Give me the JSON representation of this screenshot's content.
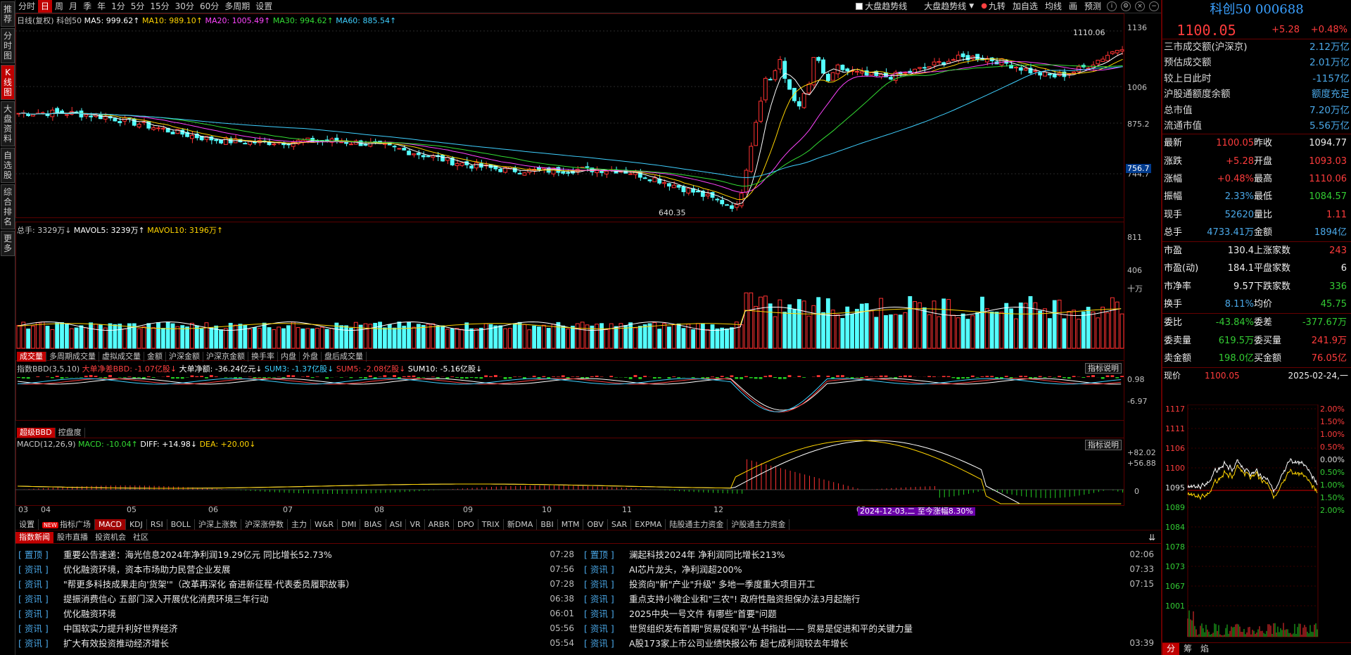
{
  "left_tabs": [
    "推荐",
    "分时图",
    "K线图",
    "大盘资料",
    "自选股",
    "综合排名",
    "更多"
  ],
  "toolbar": {
    "periods": [
      "分时",
      "日",
      "周",
      "月",
      "季",
      "年",
      "1分",
      "5分",
      "15分",
      "30分",
      "60分",
      "多周期",
      "设置"
    ],
    "active_period": "日",
    "right_items": [
      "大盘趋势线",
      "大盘趋势线",
      "九转",
      "加自选",
      "均线",
      "画",
      "预测"
    ],
    "icons": [
      "info-icon",
      "settings-icon",
      "close-icon",
      "minimize-icon"
    ]
  },
  "price_pane": {
    "title_parts": [
      {
        "t": "日线(复权)",
        "c": "#c8c8c8"
      },
      {
        "t": "科创50",
        "c": "#c8c8c8"
      },
      {
        "t": "MA5: 999.62↑",
        "c": "#ffffff"
      },
      {
        "t": "MA10: 989.10↑",
        "c": "#ffd400"
      },
      {
        "t": "MA20: 1005.49↑",
        "c": "#ff44ff"
      },
      {
        "t": "MA30: 994.62↑",
        "c": "#33dd33"
      },
      {
        "t": "MA60: 885.54↑",
        "c": "#3fd0ff"
      }
    ],
    "y_ticks": [
      "1136",
      "1006",
      "875.2",
      "744.7"
    ],
    "current_tag": "756.7",
    "high_label": "1110.06",
    "low_label": "640.35"
  },
  "volume_pane": {
    "title_parts": [
      {
        "t": "总手: 3329万↓",
        "c": "#c8c8c8"
      },
      {
        "t": "MAVOL5: 3239万↑",
        "c": "#ffffff"
      },
      {
        "t": "MAVOL10: 3196万↑",
        "c": "#ffd400"
      }
    ],
    "y_ticks": [
      "811",
      "406",
      "十万"
    ],
    "sub_tabs": [
      "成交量",
      "多周期成交量",
      "虚拟成交量",
      "金额",
      "沪深金额",
      "沪深京金额",
      "换手率",
      "内盘",
      "外盘",
      "盘后成交量"
    ]
  },
  "bbd_pane": {
    "title_parts": [
      {
        "t": "指数BBD(3,5,10)",
        "c": "#c8c8c8"
      },
      {
        "t": "大单净差BBD: -1.07亿股↓",
        "c": "#ff4040"
      },
      {
        "t": "大单净额: -36.24亿元↓",
        "c": "#ffffff"
      },
      {
        "t": "SUM3: -1.37亿股↓",
        "c": "#3fd0ff"
      },
      {
        "t": "SUM5: -2.08亿股↓",
        "c": "#ff4040"
      },
      {
        "t": "SUM10: -5.16亿股↓",
        "c": "#ffffff"
      }
    ],
    "y_ticks": [
      "0.98",
      "-6.97"
    ],
    "button": "指标说明",
    "sub_tabs": [
      "超级BBD",
      "控盘度"
    ]
  },
  "macd_pane": {
    "title_parts": [
      {
        "t": "MACD(12,26,9)",
        "c": "#c8c8c8"
      },
      {
        "t": "MACD: -10.04↑",
        "c": "#33dd33"
      },
      {
        "t": "DIFF: +14.98↓",
        "c": "#ffffff"
      },
      {
        "t": "DEA: +20.00↓",
        "c": "#ffd400"
      }
    ],
    "y_ticks": [
      "+82.02",
      "+56.88",
      "0"
    ],
    "button": "指标说明"
  },
  "x_axis": [
    "03",
    "04",
    "05",
    "06",
    "07",
    "08",
    "09",
    "10",
    "11",
    "12",
    "02"
  ],
  "indicator_tabs": [
    "设置",
    "指标广场",
    "MACD",
    "KDJ",
    "RSI",
    "BOLL",
    "沪深上涨数",
    "沪深涨停数",
    "主力",
    "W&R",
    "DMI",
    "BIAS",
    "ASI",
    "VR",
    "ARBR",
    "DPO",
    "TRIX",
    "新DMA",
    "BBI",
    "MTM",
    "OBV",
    "SAR",
    "EXPMA",
    "陆股通主力资金",
    "沪股通主力资金"
  ],
  "active_indicator": "MACD",
  "new_badge": "NEW",
  "range_tag": "2024-12-03,二 至今涨幅8.30%",
  "news_tabs": [
    "指数新闻",
    "股市直播",
    "投资机会",
    "社区"
  ],
  "news_left": [
    {
      "tag": "[ 置顶 ]",
      "title": "重要公告速递：海光信息2024年净利润19.29亿元 同比增长52.73%",
      "time": "07:28"
    },
    {
      "tag": "[ 资讯 ]",
      "title": "优化融资环境，资本市场助力民营企业发展",
      "time": "07:56"
    },
    {
      "tag": "[ 资讯 ]",
      "title": "\"帮更多科技成果走向'货架'\"（改革再深化 奋进新征程·代表委员履职故事）",
      "time": "07:28"
    },
    {
      "tag": "[ 资讯 ]",
      "title": "提振消费信心 五部门深入开展优化消费环境三年行动",
      "time": "06:38"
    },
    {
      "tag": "[ 资讯 ]",
      "title": "优化融资环境",
      "time": "06:01"
    },
    {
      "tag": "[ 资讯 ]",
      "title": "中国软实力提升利好世界经济",
      "time": "05:56"
    },
    {
      "tag": "[ 资讯 ]",
      "title": "扩大有效投资推动经济增长",
      "time": "05:54"
    }
  ],
  "news_right": [
    {
      "tag": "[ 置顶 ]",
      "title": "澜起科技2024年 净利润同比增长213%",
      "time": "02:06"
    },
    {
      "tag": "[ 资讯 ]",
      "title": "AI芯片龙头，净利润超200%",
      "time": "07:33"
    },
    {
      "tag": "[ 资讯 ]",
      "title": "投资向\"新\"产业\"升级\" 多地一季度重大项目开工",
      "time": "07:15"
    },
    {
      "tag": "[ 资讯 ]",
      "title": "重点支持小微企业和\"三农\"! 政府性融资担保办法3月起施行",
      "time": ""
    },
    {
      "tag": "[ 资讯 ]",
      "title": "2025中央一号文件 有哪些\"首要\"问题",
      "time": ""
    },
    {
      "tag": "[ 资讯 ]",
      "title": "世贸组织发布首期\"贸易促和平\"丛书指出—— 贸易是促进和平的关键力量",
      "time": ""
    },
    {
      "tag": "[ 资讯 ]",
      "title": "A股173家上市公司业绩快报公布 超七成利润较去年增长",
      "time": "03:39"
    }
  ],
  "quote": {
    "name": "科创50 000688",
    "price": "1100.05",
    "change": "+5.28",
    "pct": "+0.48%",
    "market_rows": [
      {
        "k": "三市成交额(沪深京)",
        "v": "2.12万亿"
      },
      {
        "k": "预估成交额",
        "v": "2.01万亿"
      },
      {
        "k": "较上日此时",
        "v": "-1157亿"
      },
      {
        "k": "沪股通额度余额",
        "v": "额度充足"
      },
      {
        "k": "总市值",
        "v": "7.20万亿"
      },
      {
        "k": "流通市值",
        "v": "5.56万亿"
      }
    ],
    "grid1": [
      [
        "最新",
        "1100.05",
        "昨收",
        "1094.77"
      ],
      [
        "涨跌",
        "+5.28",
        "开盘",
        "1093.03"
      ],
      [
        "涨幅",
        "+0.48%",
        "最高",
        "1110.06"
      ],
      [
        "振幅",
        "2.33%",
        "最低",
        "1084.57"
      ],
      [
        "现手",
        "52620",
        "量比",
        "1.11"
      ],
      [
        "总手",
        "4733.41万",
        "金额",
        "1894亿"
      ]
    ],
    "grid2": [
      [
        "市盈",
        "130.4",
        "上涨家数",
        "243"
      ],
      [
        "市盈(动)",
        "184.1",
        "平盘家数",
        "6"
      ],
      [
        "市净率",
        "9.57",
        "下跌家数",
        "336"
      ],
      [
        "换手",
        "8.11%",
        "均价",
        "45.75"
      ]
    ],
    "grid3": [
      [
        "委比",
        "-43.84%",
        "委差",
        "-377.67万"
      ],
      [
        "委卖量",
        "619.5万",
        "委买量",
        "241.9万"
      ],
      [
        "卖金额",
        "198.0亿",
        "买金额",
        "76.05亿"
      ]
    ],
    "now_row": {
      "k": "现价",
      "v": "1100.05",
      "d": "2025-02-24,一"
    },
    "mini_left": [
      "1117",
      "1111",
      "1106",
      "1100",
      "1095",
      "1089",
      "1084",
      "1078",
      "1073",
      "1067",
      "1001"
    ],
    "mini_right": [
      "2.00%",
      "1.50%",
      "1.00%",
      "0.50%",
      "0.00%",
      "0.50%",
      "1.00%",
      "1.50%",
      "2.00%"
    ],
    "bottom_tabs": [
      "分",
      "筹",
      "焰"
    ]
  }
}
